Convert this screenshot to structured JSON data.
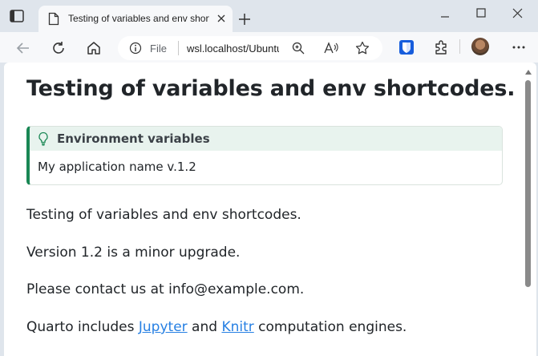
{
  "browser": {
    "tab_title": "Testing of variables and env shortcodes.",
    "address_scheme": "File",
    "address_url": "wsl.localhost/Ubuntu/home/user/project/index.html"
  },
  "page": {
    "title": "Testing of variables and env shortcodes.",
    "callout": {
      "title": "Environment variables",
      "body": "My application name v.1.2",
      "accent_color": "#198754"
    },
    "paragraphs": {
      "p1": "Testing of variables and env shortcodes.",
      "p2": "Version 1.2 is a minor upgrade.",
      "p3": "Please contact us at info@example.com.",
      "p4_prefix": "Quarto includes ",
      "p4_link1": "Jupyter",
      "p4_mid": " and ",
      "p4_link2": "Knitr",
      "p4_suffix": " computation engines."
    }
  },
  "colors": {
    "link": "#2780e3",
    "text": "#212529"
  }
}
